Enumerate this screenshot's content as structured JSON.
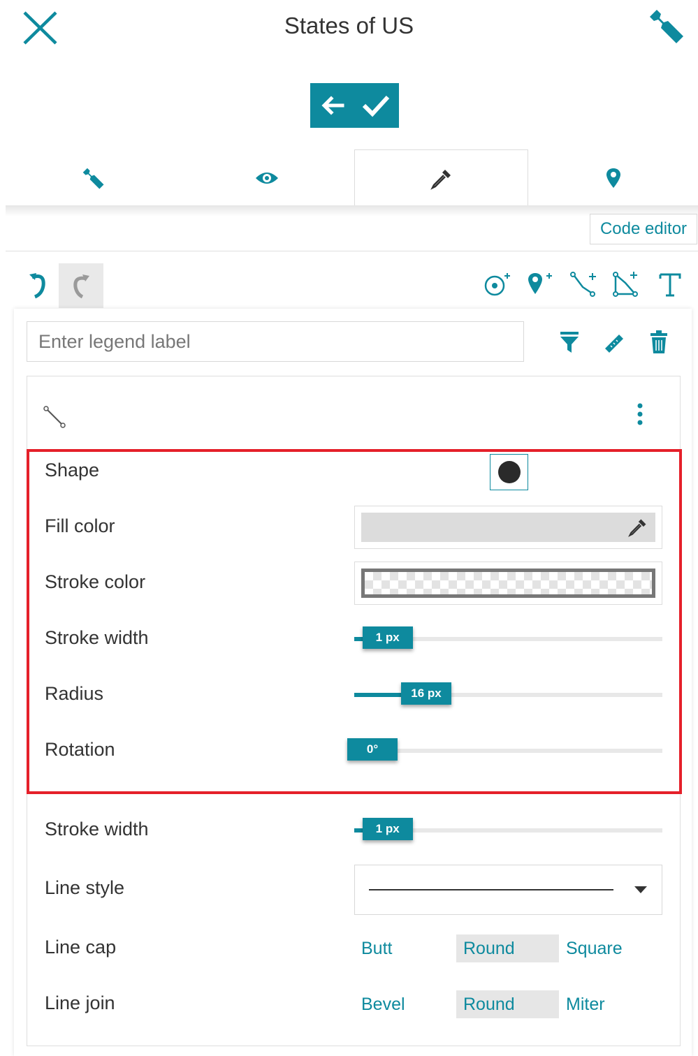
{
  "header": {
    "title": "States of US",
    "close_icon": "close-icon",
    "settings_icon": "wrench-icon",
    "actions": [
      {
        "name": "back-button",
        "icon": "arrow-left-icon"
      },
      {
        "name": "confirm-button",
        "icon": "check-icon"
      }
    ]
  },
  "tabs": [
    {
      "name": "tab-settings",
      "icon": "wrench-icon",
      "active": false
    },
    {
      "name": "tab-visibility",
      "icon": "eye-icon",
      "active": false
    },
    {
      "name": "tab-style",
      "icon": "eyedropper-icon",
      "active": true
    },
    {
      "name": "tab-location",
      "icon": "map-pin-icon",
      "active": false
    }
  ],
  "code_editor_label": "Code editor",
  "toolbar": {
    "undo_icon": "undo-icon",
    "redo_icon": "redo-icon",
    "tools": [
      "add-point-icon",
      "add-marker-icon",
      "add-line-icon",
      "add-polygon-icon",
      "add-text-icon"
    ]
  },
  "legend": {
    "placeholder": "Enter legend label",
    "value": "",
    "tools": [
      "filter-icon",
      "ruler-icon",
      "trash-icon"
    ]
  },
  "style": {
    "type_icon": "line-icon",
    "more_icon": "more-vertical-icon",
    "labels": {
      "shape": "Shape",
      "fill_color": "Fill color",
      "stroke_color": "Stroke color",
      "stroke_width": "Stroke width",
      "radius": "Radius",
      "rotation": "Rotation",
      "line_stroke_width": "Stroke width",
      "line_style": "Line style",
      "line_cap": "Line cap",
      "line_join": "Line join"
    },
    "shape_value": "circle",
    "fill_color": "#dcdcdc",
    "stroke_color": "transparent",
    "stroke_width_value": "1 px",
    "stroke_width_fraction": 0.01,
    "radius_value": "16 px",
    "radius_fraction": 0.16,
    "rotation_value": "0°",
    "rotation_fraction": 0.0,
    "line_stroke_width_value": "1 px",
    "line_stroke_width_fraction": 0.01,
    "line_style_value": "solid",
    "line_cap_options": [
      {
        "label": "Butt",
        "selected": false
      },
      {
        "label": "Round",
        "selected": true
      },
      {
        "label": "Square",
        "selected": false
      }
    ],
    "line_join_options": [
      {
        "label": "Bevel",
        "selected": false
      },
      {
        "label": "Round",
        "selected": true
      },
      {
        "label": "Miter",
        "selected": false
      }
    ]
  },
  "colors": {
    "accent": "#0e8a9e",
    "highlight": "#e5202a"
  }
}
